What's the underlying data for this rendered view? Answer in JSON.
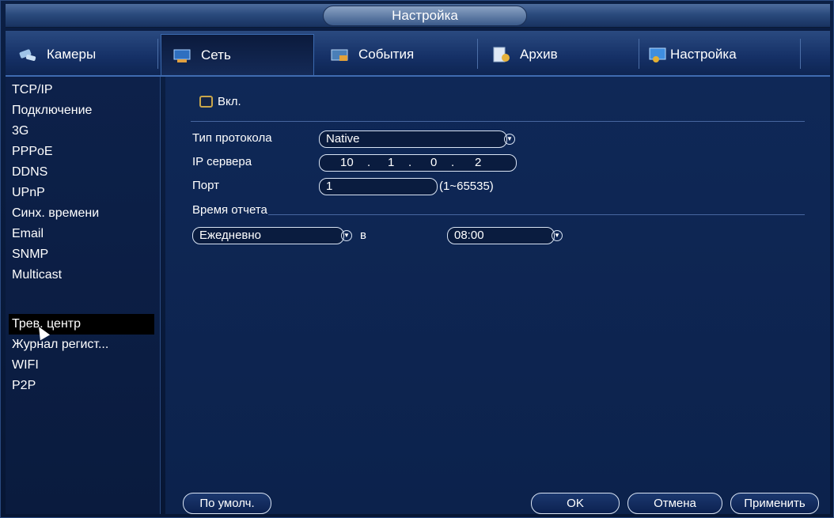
{
  "window": {
    "title": "Настройка"
  },
  "tabs": [
    {
      "label": "Камеры",
      "icon": "cameras-icon",
      "active": false
    },
    {
      "label": "Сеть",
      "icon": "network-icon",
      "active": true
    },
    {
      "label": "События",
      "icon": "events-icon",
      "active": false
    },
    {
      "label": "Архив",
      "icon": "archive-icon",
      "active": false
    },
    {
      "label": "Настройка",
      "icon": "settings-icon",
      "active": false
    }
  ],
  "sidebar": {
    "items": [
      {
        "label": "TCP/IP"
      },
      {
        "label": "Подключение"
      },
      {
        "label": "3G"
      },
      {
        "label": "PPPoE"
      },
      {
        "label": "DDNS"
      },
      {
        "label": "UPnP"
      },
      {
        "label": "Синх. времени"
      },
      {
        "label": "Email"
      },
      {
        "label": "SNMP"
      },
      {
        "label": "Multicast"
      },
      {
        "label": "Трев. центр",
        "selected": true
      },
      {
        "label": "Журнал регист..."
      },
      {
        "label": "WIFI"
      },
      {
        "label": "P2P"
      }
    ]
  },
  "form": {
    "enable_label": "Вкл.",
    "enable_checked": false,
    "protocol_label": "Тип протокола",
    "protocol_value": "Native",
    "server_ip_label": "IP сервера",
    "server_ip": [
      "10",
      "1",
      "0",
      "2"
    ],
    "port_label": "Порт",
    "port_value": "1",
    "port_range": "(1~65535)",
    "report_time_label": "Время отчета",
    "period_value": "Ежедневно",
    "at_label": "в",
    "time_value": "08:00"
  },
  "buttons": {
    "default": "По умолч.",
    "ok": "OK",
    "cancel": "Отмена",
    "apply": "Применить"
  }
}
